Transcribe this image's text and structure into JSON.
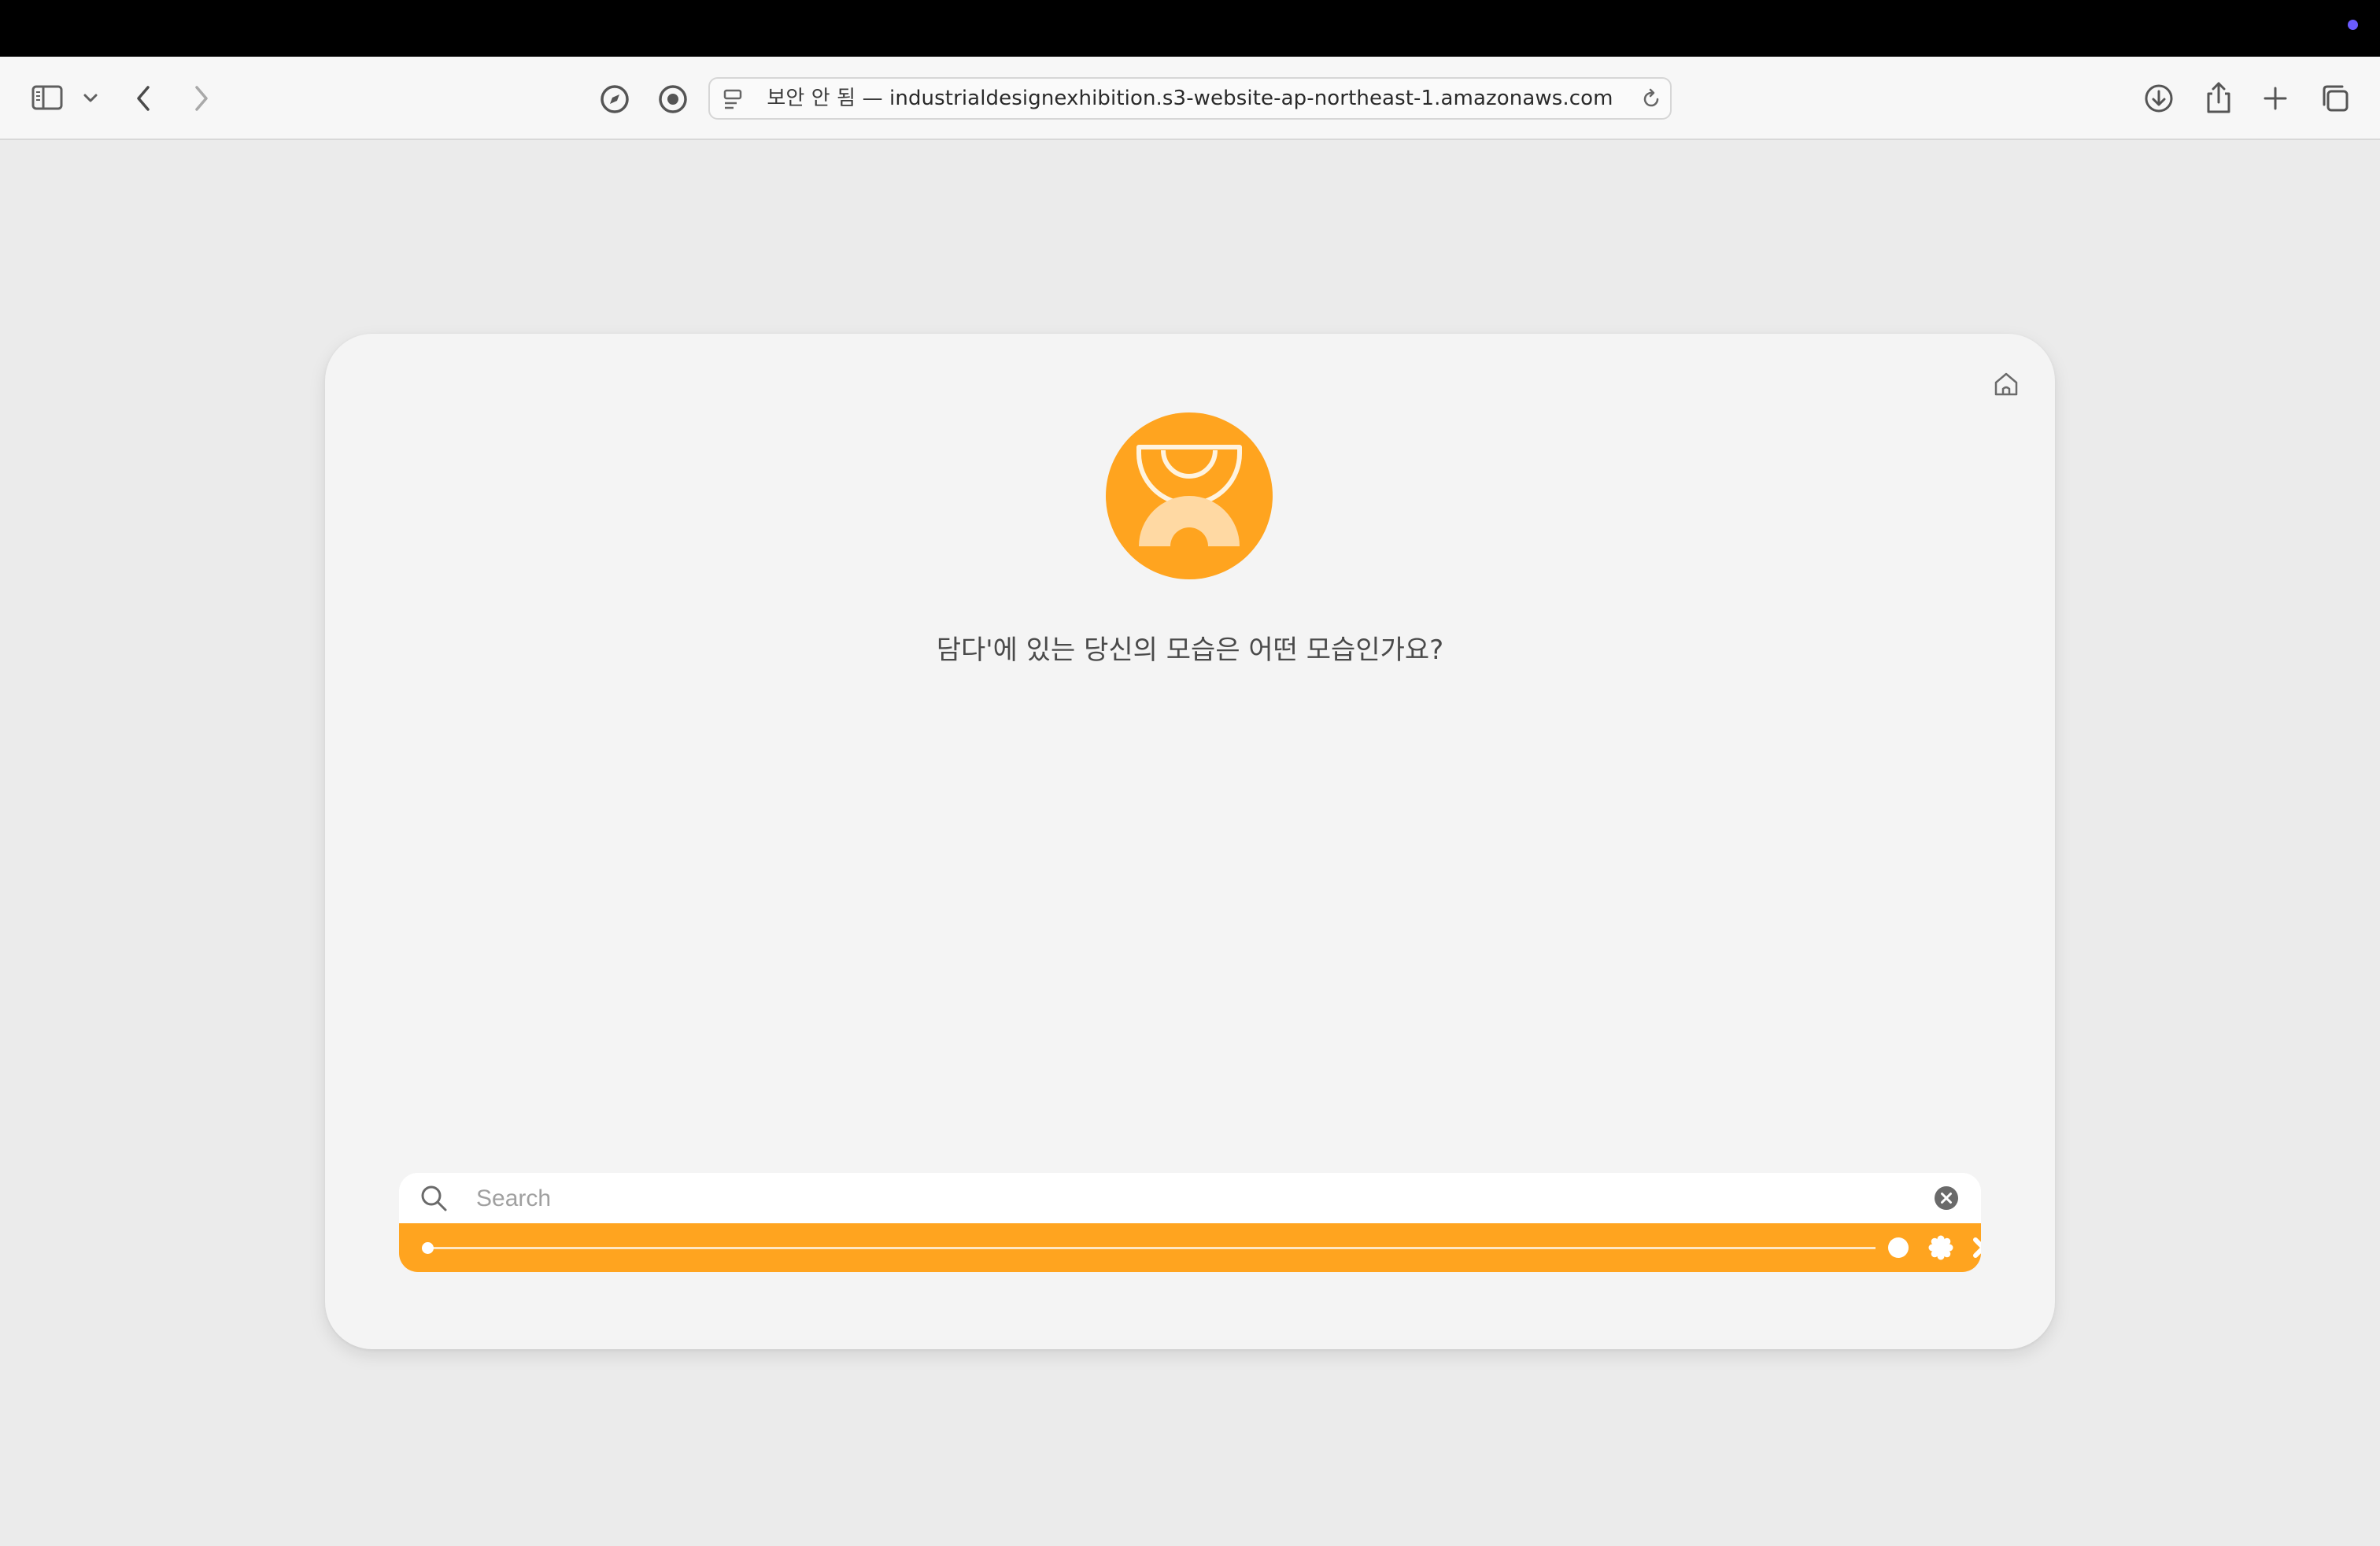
{
  "browser": {
    "url_security_label": "보안 안 됨 —",
    "url_domain": "industrialdesignexhibition.s3-website-ap-northeast-1.amazonaws.com"
  },
  "page": {
    "question": "담다'에 있는 당신의 모습은 어떤 모습인가요?",
    "search": {
      "placeholder": "Search",
      "value": ""
    },
    "slider": {
      "level": 0.0
    },
    "shape_icons": [
      "circle-shape-icon",
      "flower-shape-icon",
      "cross-shape-icon",
      "ring-shape-icon"
    ]
  },
  "colors": {
    "accent": "#ffa41f",
    "card": "#f4f4f4",
    "page_bg": "#ebebeb"
  }
}
